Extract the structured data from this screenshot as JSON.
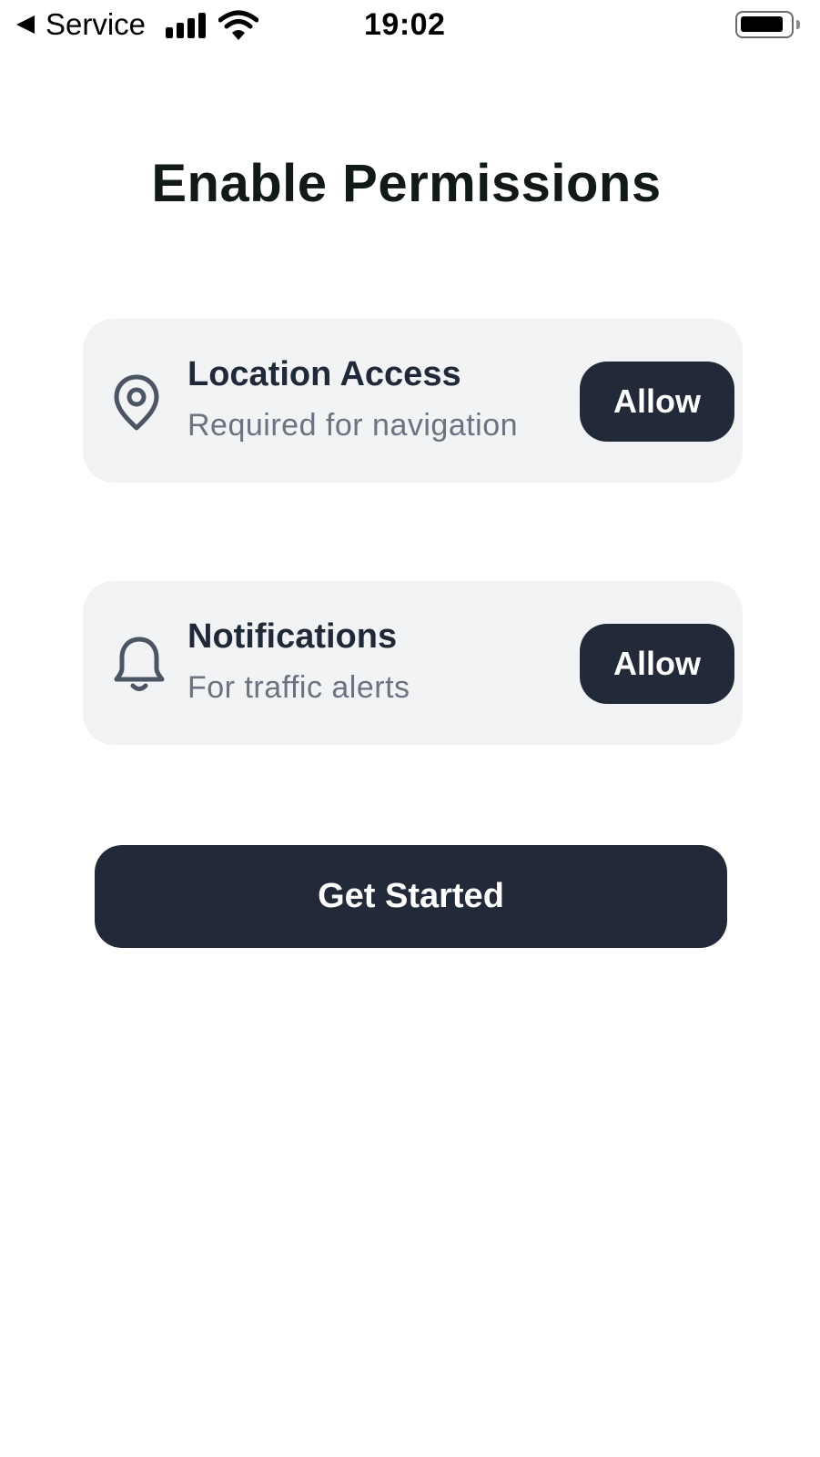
{
  "status_bar": {
    "carrier": "Service",
    "time": "19:02",
    "icons": [
      "back-arrow-icon",
      "signal-icon",
      "wifi-icon",
      "battery-icon"
    ]
  },
  "title": "Enable Permissions",
  "permissions": [
    {
      "icon": "location-pin-icon",
      "title": "Location Access",
      "description": "Required for navigation",
      "button": "Allow"
    },
    {
      "icon": "bell-icon",
      "title": "Notifications",
      "description": "For traffic alerts",
      "button": "Allow"
    }
  ],
  "cta": {
    "label": "Get Started"
  },
  "colors": {
    "card_bg": "#f2f3f5",
    "button_bg": "#222938",
    "title_text": "#111a14",
    "muted_text": "#6b7280"
  }
}
